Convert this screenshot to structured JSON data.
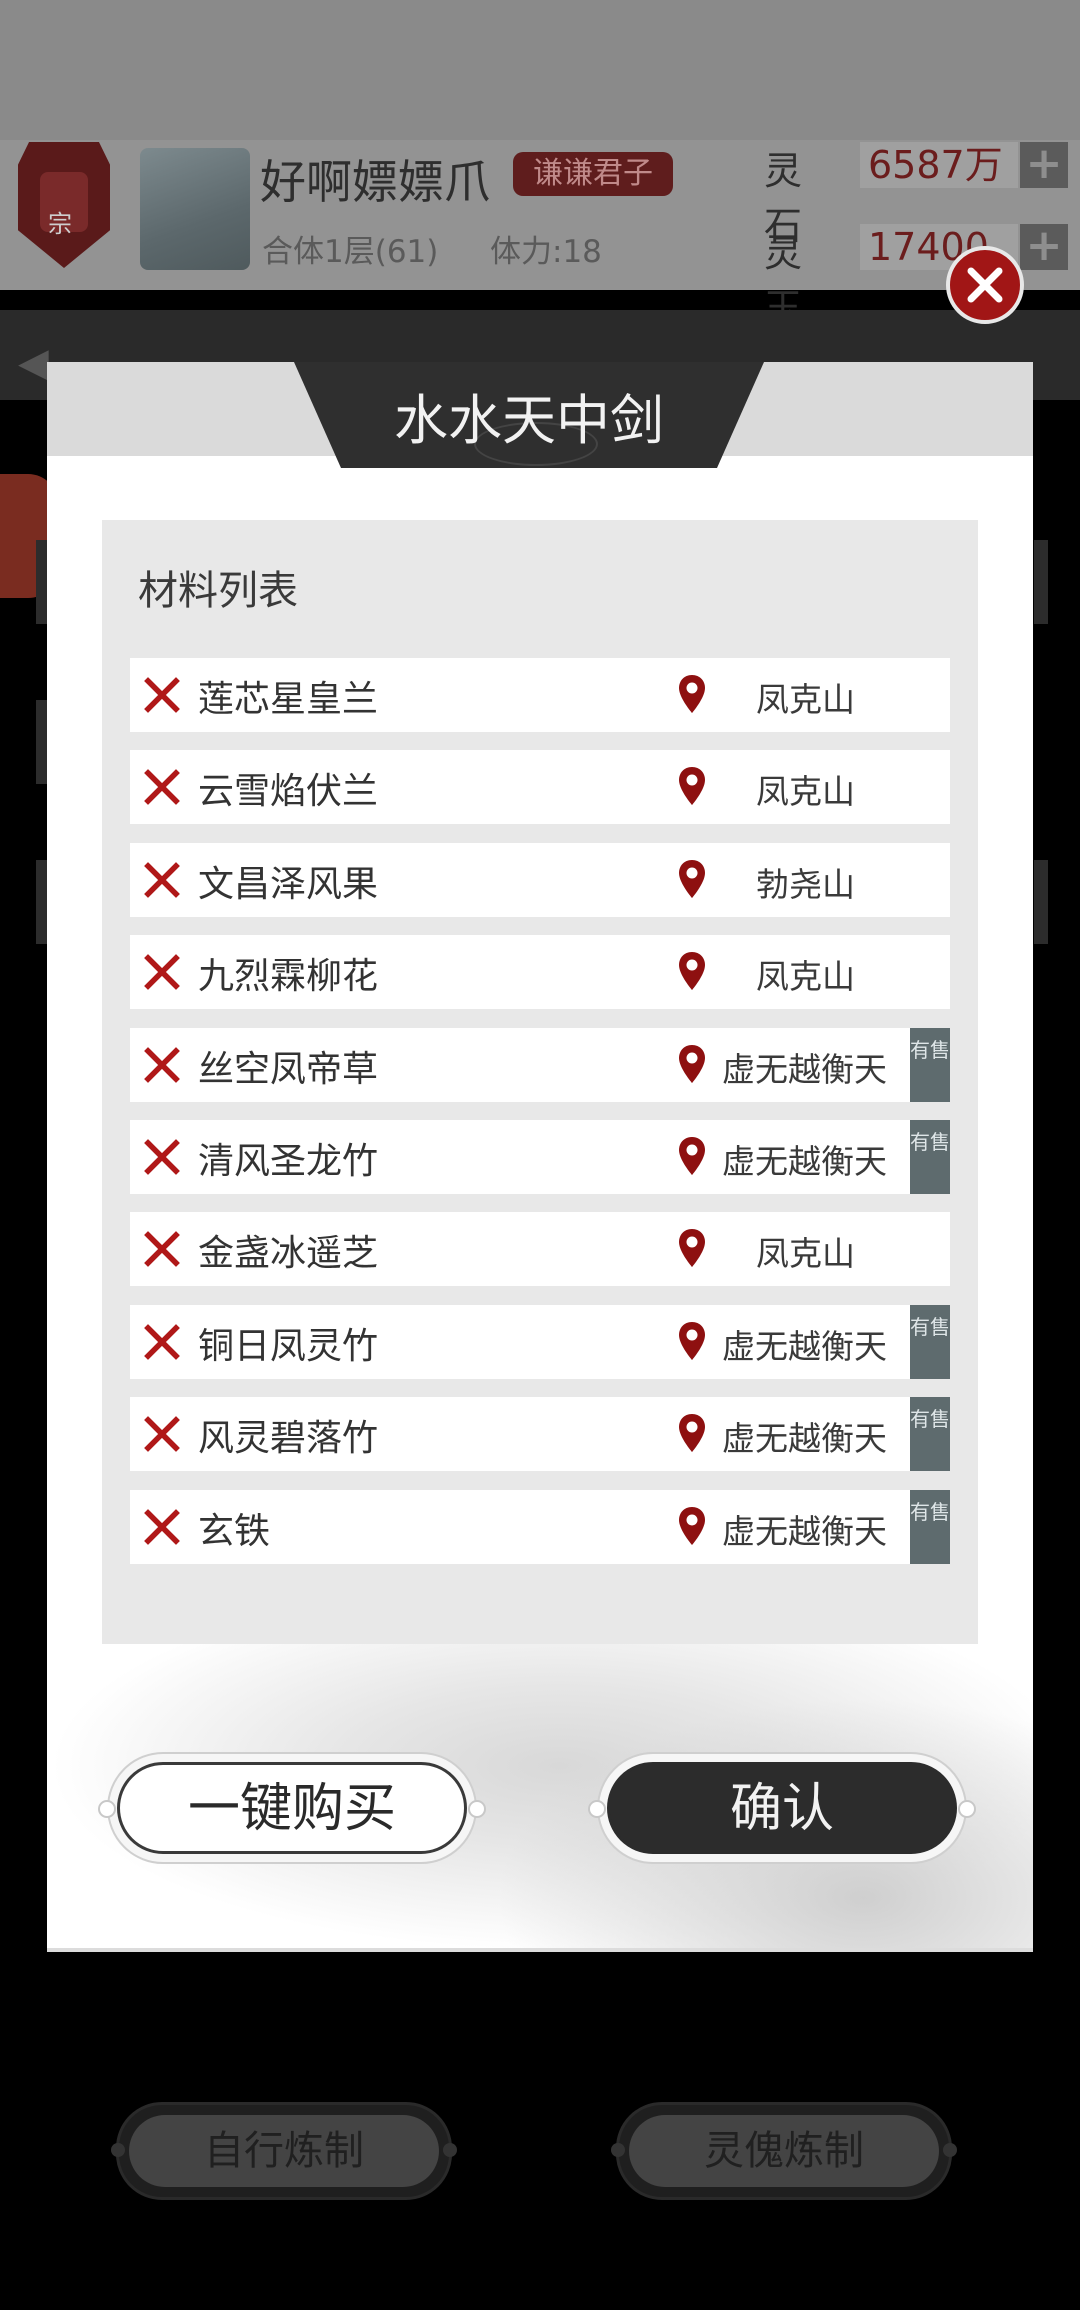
{
  "background": {
    "player": {
      "name": "好啊嫖嫖爪",
      "title_badge": "谦谦君子",
      "realm": "合体1层(61)",
      "stamina": "体力:18",
      "sect_badge_text": "宗"
    },
    "currencies": [
      {
        "label": "灵石",
        "value": "6587万"
      },
      {
        "label": "灵玉",
        "value": "17400"
      }
    ],
    "bottom_buttons": [
      "自行炼制",
      "灵傀炼制"
    ]
  },
  "modal": {
    "title": "水水天中剑",
    "list_heading": "材料列表",
    "materials": [
      {
        "name": "莲芯星皇兰",
        "location": "凤克山",
        "on_sale": false
      },
      {
        "name": "云雪焰伏兰",
        "location": "凤克山",
        "on_sale": false
      },
      {
        "name": "文昌泽风果",
        "location": "勃尧山",
        "on_sale": false
      },
      {
        "name": "九烈霖柳花",
        "location": "凤克山",
        "on_sale": false
      },
      {
        "name": "丝空凤帝草",
        "location": "虚无越衡天",
        "on_sale": true
      },
      {
        "name": "清风圣龙竹",
        "location": "虚无越衡天",
        "on_sale": true
      },
      {
        "name": "金盏冰遥芝",
        "location": "凤克山",
        "on_sale": false
      },
      {
        "name": "铜日凤灵竹",
        "location": "虚无越衡天",
        "on_sale": true
      },
      {
        "name": "风灵碧落竹",
        "location": "虚无越衡天",
        "on_sale": true
      },
      {
        "name": "玄铁",
        "location": "虚无越衡天",
        "on_sale": true
      }
    ],
    "sale_badge_text": "有售",
    "buy_all_label": "一键购买",
    "confirm_label": "确认"
  },
  "colors": {
    "missing_mark": "#b01818",
    "location_pin": "#8e1010",
    "sale_badge": "#5e6b6e",
    "confirm_fill": "#2c2c2c"
  },
  "icons": {
    "close": "close-icon",
    "missing": "x-mark-icon",
    "location": "map-pin-icon"
  }
}
